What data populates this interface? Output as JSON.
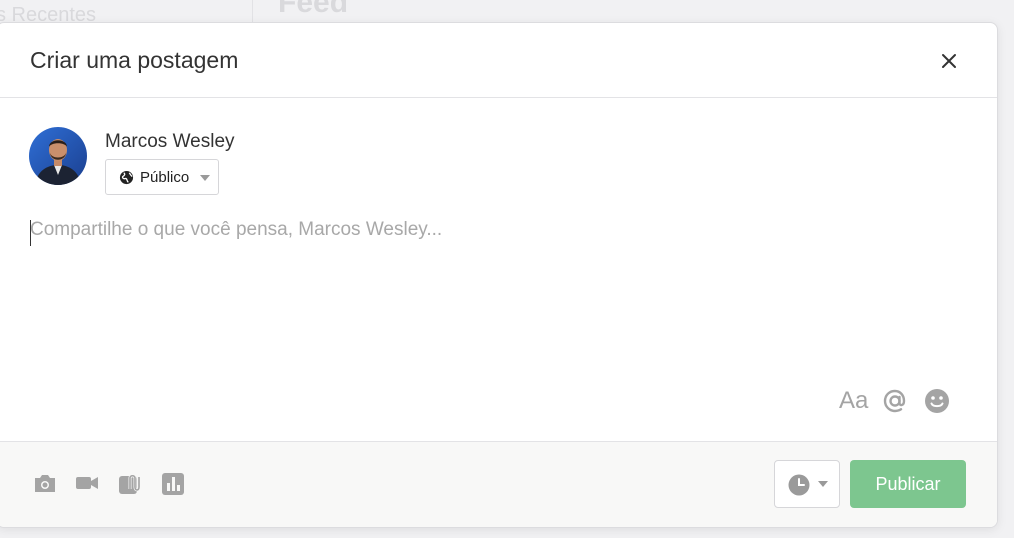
{
  "background": {
    "sidebar_title": "s Recentes",
    "feed_title": "Feed"
  },
  "modal": {
    "title": "Criar uma postagem",
    "close_icon": "close-icon"
  },
  "author": {
    "name": "Marcos Wesley",
    "audience_label": "Público",
    "audience_icon": "globe-icon"
  },
  "composer": {
    "value": "",
    "placeholder": "Compartilhe o que você pensa, Marcos Wesley..."
  },
  "format_tools": {
    "text_format_label": "Aa",
    "mention_icon": "at-icon",
    "emoji_icon": "emoji-icon"
  },
  "footer": {
    "attachments": [
      "camera-icon",
      "video-icon",
      "paperclip-icon",
      "poll-icon"
    ],
    "schedule_icon": "clock-icon",
    "publish_label": "Publicar"
  },
  "colors": {
    "publish_button": "#7dc68f",
    "icon_gray": "#a4a4a4",
    "footer_bg": "#f8f8f7"
  }
}
